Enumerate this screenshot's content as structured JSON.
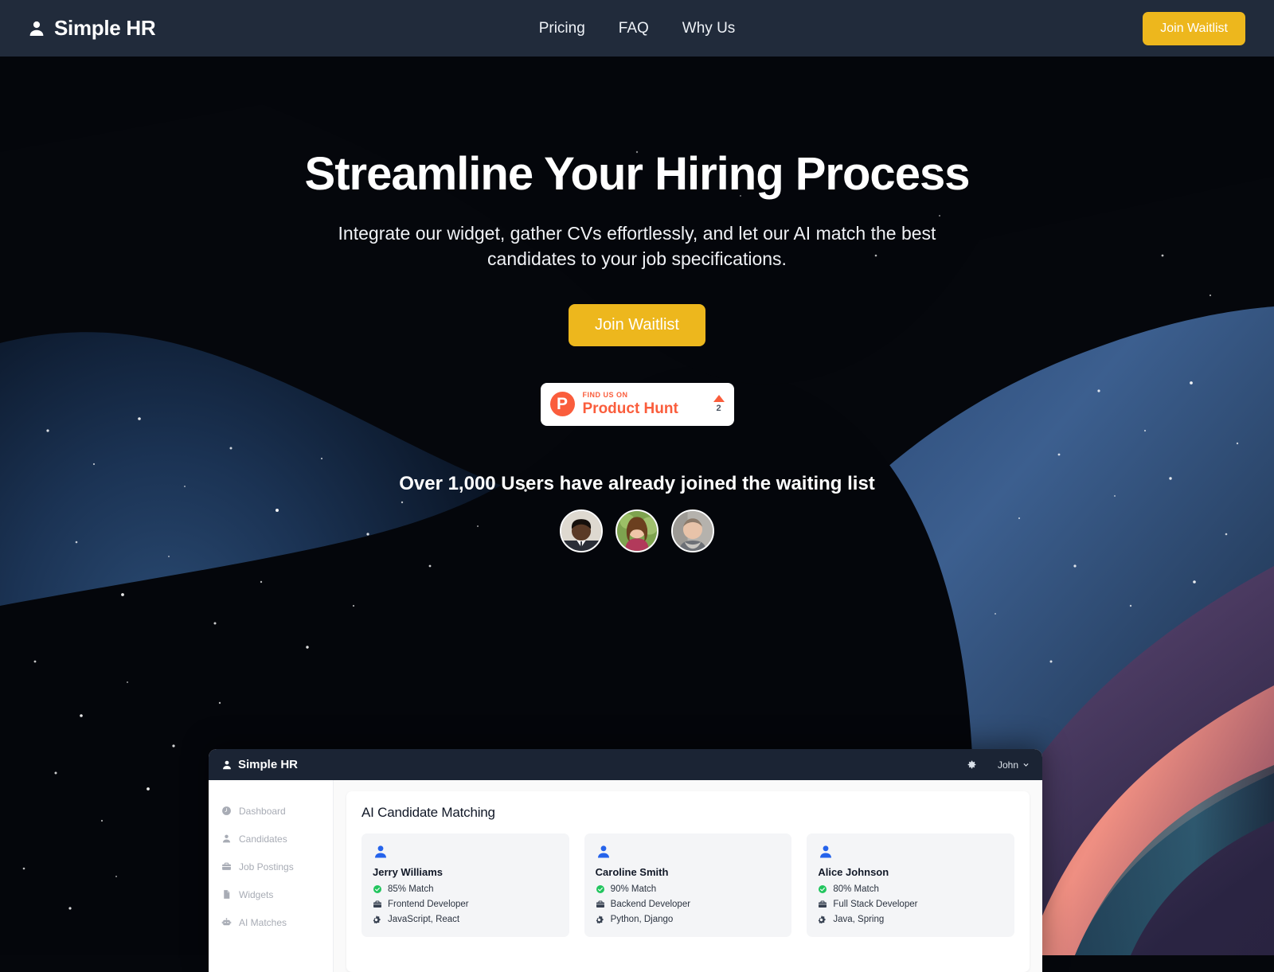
{
  "navbar": {
    "brand": "Simple HR",
    "brand_icon": "user-icon",
    "links": [
      {
        "label": "Pricing"
      },
      {
        "label": "FAQ"
      },
      {
        "label": "Why Us"
      }
    ],
    "cta_label": "Join Waitlist",
    "background_color": "#212b3b",
    "accent_color": "#edb71d"
  },
  "hero": {
    "title": "Streamline Your Hiring Process",
    "subtitle": "Integrate our widget, gather CVs effortlessly, and let our AI match the best candidates to your job specifications.",
    "cta_label": "Join Waitlist",
    "product_hunt": {
      "logo_letter": "P",
      "eyebrow": "FIND US ON",
      "name": "Product Hunt",
      "upvote_icon": "triangle-up-icon",
      "upvote_count": "2",
      "brand_color": "#fa5d3c"
    },
    "social_proof": {
      "text": "Over 1,000 Users have already joined the waiting list",
      "avatars": [
        {
          "name": "avatar-user-1"
        },
        {
          "name": "avatar-user-2"
        },
        {
          "name": "avatar-user-3"
        }
      ]
    }
  },
  "dashboard": {
    "brand": "Simple HR",
    "brand_icon": "user-icon",
    "settings_icon": "gear-icon",
    "user_name": "John",
    "user_chevron": "chevron-down-icon",
    "sidebar": [
      {
        "label": "Dashboard",
        "icon": "clock-icon"
      },
      {
        "label": "Candidates",
        "icon": "user-icon"
      },
      {
        "label": "Job Postings",
        "icon": "briefcase-icon"
      },
      {
        "label": "Widgets",
        "icon": "document-icon"
      },
      {
        "label": "AI Matches",
        "icon": "robot-icon"
      }
    ],
    "panel_title": "AI Candidate Matching",
    "candidates": [
      {
        "name": "Jerry Williams",
        "match": "85% Match",
        "role": "Frontend Developer",
        "skills": "JavaScript, React"
      },
      {
        "name": "Caroline Smith",
        "match": "90% Match",
        "role": "Backend Developer",
        "skills": "Python, Django"
      },
      {
        "name": "Alice Johnson",
        "match": "80% Match",
        "role": "Full Stack Developer",
        "skills": "Java, Spring"
      }
    ],
    "match_icon": "check-circle-icon",
    "role_icon": "briefcase-icon",
    "skills_icon": "gears-icon",
    "avatar_icon": "user-icon"
  }
}
